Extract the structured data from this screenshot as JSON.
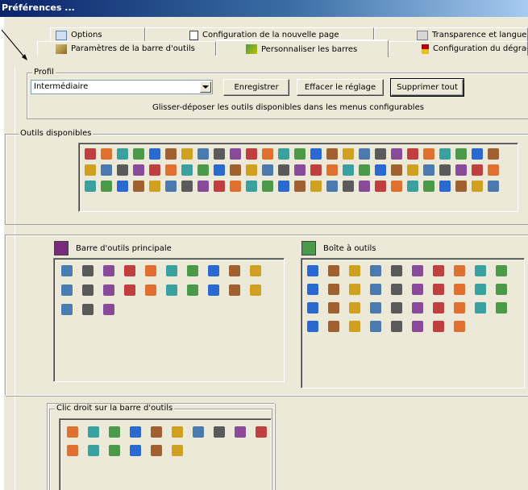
{
  "window": {
    "title": "Préférences ..."
  },
  "tabs_top": [
    {
      "label": "Options",
      "icon": "options-icon"
    },
    {
      "label": "Configuration de la nouvelle page",
      "icon": "new-page-icon"
    },
    {
      "label": "Transparence et langue",
      "icon": "transparency-icon"
    }
  ],
  "tabs_bottom": [
    {
      "label": "Paramètres de la barre d'outils",
      "icon": "toolbar-settings-icon"
    },
    {
      "label": "Personnaliser les barres",
      "icon": "customize-bars-icon",
      "selected": true
    },
    {
      "label": "Configuration du dégradé",
      "icon": "gradient-config-icon"
    }
  ],
  "profile": {
    "legend": "Profil",
    "selected": "Intermédiaire",
    "buttons": {
      "save": "Enregistrer",
      "reset": "Effacer le réglage",
      "delete_all": "Supprimer tout"
    }
  },
  "hint": "Glisser-déposer les outils disponibles dans les menus configurables",
  "available": {
    "legend": "Outils disponibles"
  },
  "main_toolbar": {
    "label": "Barre d'outils principale"
  },
  "toolbox": {
    "label": "Boîte à outils"
  },
  "right_click": {
    "legend": "Clic droit sur la barre d'outils"
  },
  "colors": {
    "titlebar_start": "#0a246a",
    "titlebar_end": "#a6caf0",
    "face": "#ece9d8"
  }
}
